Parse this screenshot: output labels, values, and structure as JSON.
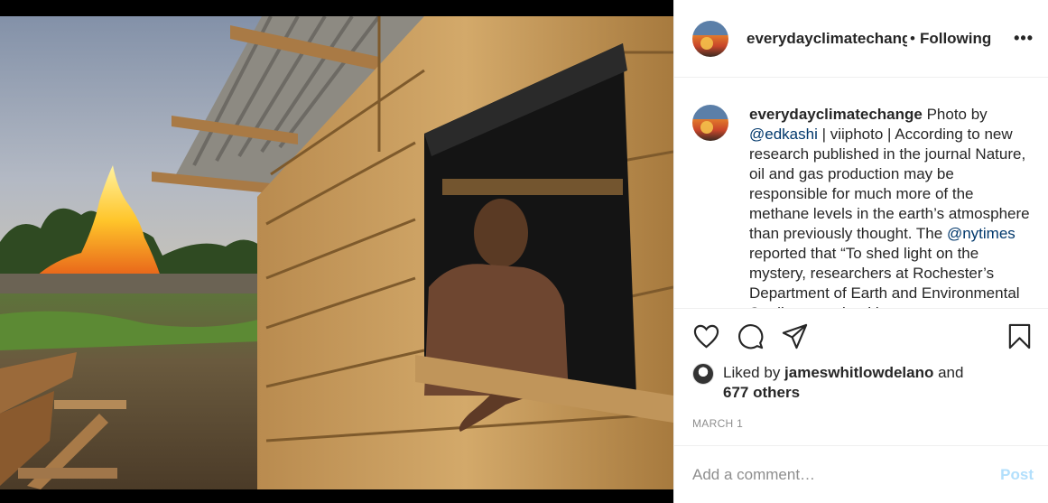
{
  "post": {
    "username": "everydayclimatechange",
    "follow_status": "Following",
    "separator": "•",
    "more_label": "•••"
  },
  "caption": {
    "username": "everydayclimatechange",
    "part1": " Photo by ",
    "mention1": "@edkashi",
    "part2": " | viiphoto | According to new research published in the journal Nature, oil and gas production may be responsible for much more of the methane levels in the earth’s atmosphere than previously thought. The ",
    "mention2": "@nytimes",
    "part3": " reported that “To shed light on the mystery, researchers at Rochester’s Department of Earth and Environmental Studies examined ice"
  },
  "actions": {
    "like_icon": "heart-icon",
    "comment_icon": "comment-icon",
    "share_icon": "paper-plane-icon",
    "save_icon": "bookmark-icon"
  },
  "likes": {
    "prefix": "Liked by ",
    "user": "jameswhitlowdelano",
    "suffix": " and",
    "others": "677 others"
  },
  "date": "MARCH 1",
  "comment_box": {
    "placeholder": "Add a comment…",
    "post_label": "Post"
  },
  "colors": {
    "link": "#00376b",
    "post_disabled": "#b2dffc",
    "muted": "#8e8e8e"
  }
}
